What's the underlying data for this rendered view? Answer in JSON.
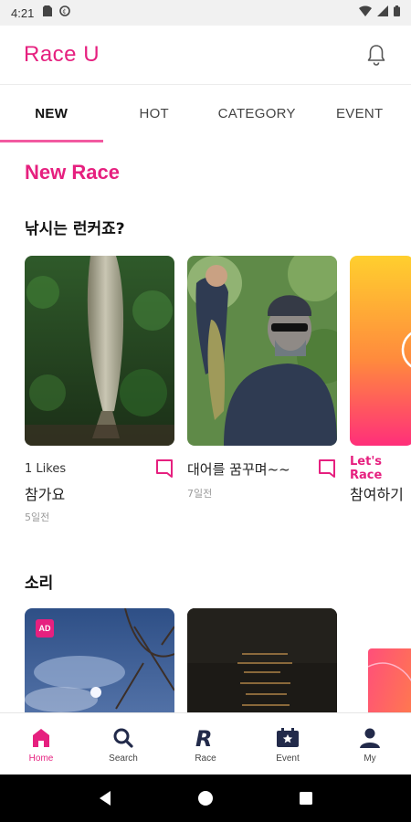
{
  "status_bar": {
    "time": "4:21"
  },
  "app": {
    "title": "Race U"
  },
  "tabs": [
    {
      "label": "NEW",
      "active": true
    },
    {
      "label": "HOT"
    },
    {
      "label": "CATEGORY"
    },
    {
      "label": "EVENT"
    }
  ],
  "main": {
    "section_title": "New Race",
    "groups": [
      {
        "title": "낚시는 런커죠?",
        "cards": [
          {
            "likes": "1 Likes",
            "title": "참가요",
            "date": "5일전"
          },
          {
            "title": "대어를 꿈꾸며~~",
            "date": "7일전"
          },
          {
            "likes": "Let's Race",
            "title": "참여하기"
          }
        ]
      },
      {
        "title": "소리",
        "cards": [
          {
            "badge": "AD"
          },
          {},
          {}
        ]
      }
    ]
  },
  "bottom_nav": [
    {
      "label": "Home",
      "icon": "home-icon",
      "active": true
    },
    {
      "label": "Search",
      "icon": "search-icon"
    },
    {
      "label": "Race",
      "icon": "race-logo-icon"
    },
    {
      "label": "Event",
      "icon": "event-calendar-icon"
    },
    {
      "label": "My",
      "icon": "person-icon"
    }
  ],
  "colors": {
    "accent": "#e6207f",
    "tab_indicator": "#f25aa0"
  }
}
